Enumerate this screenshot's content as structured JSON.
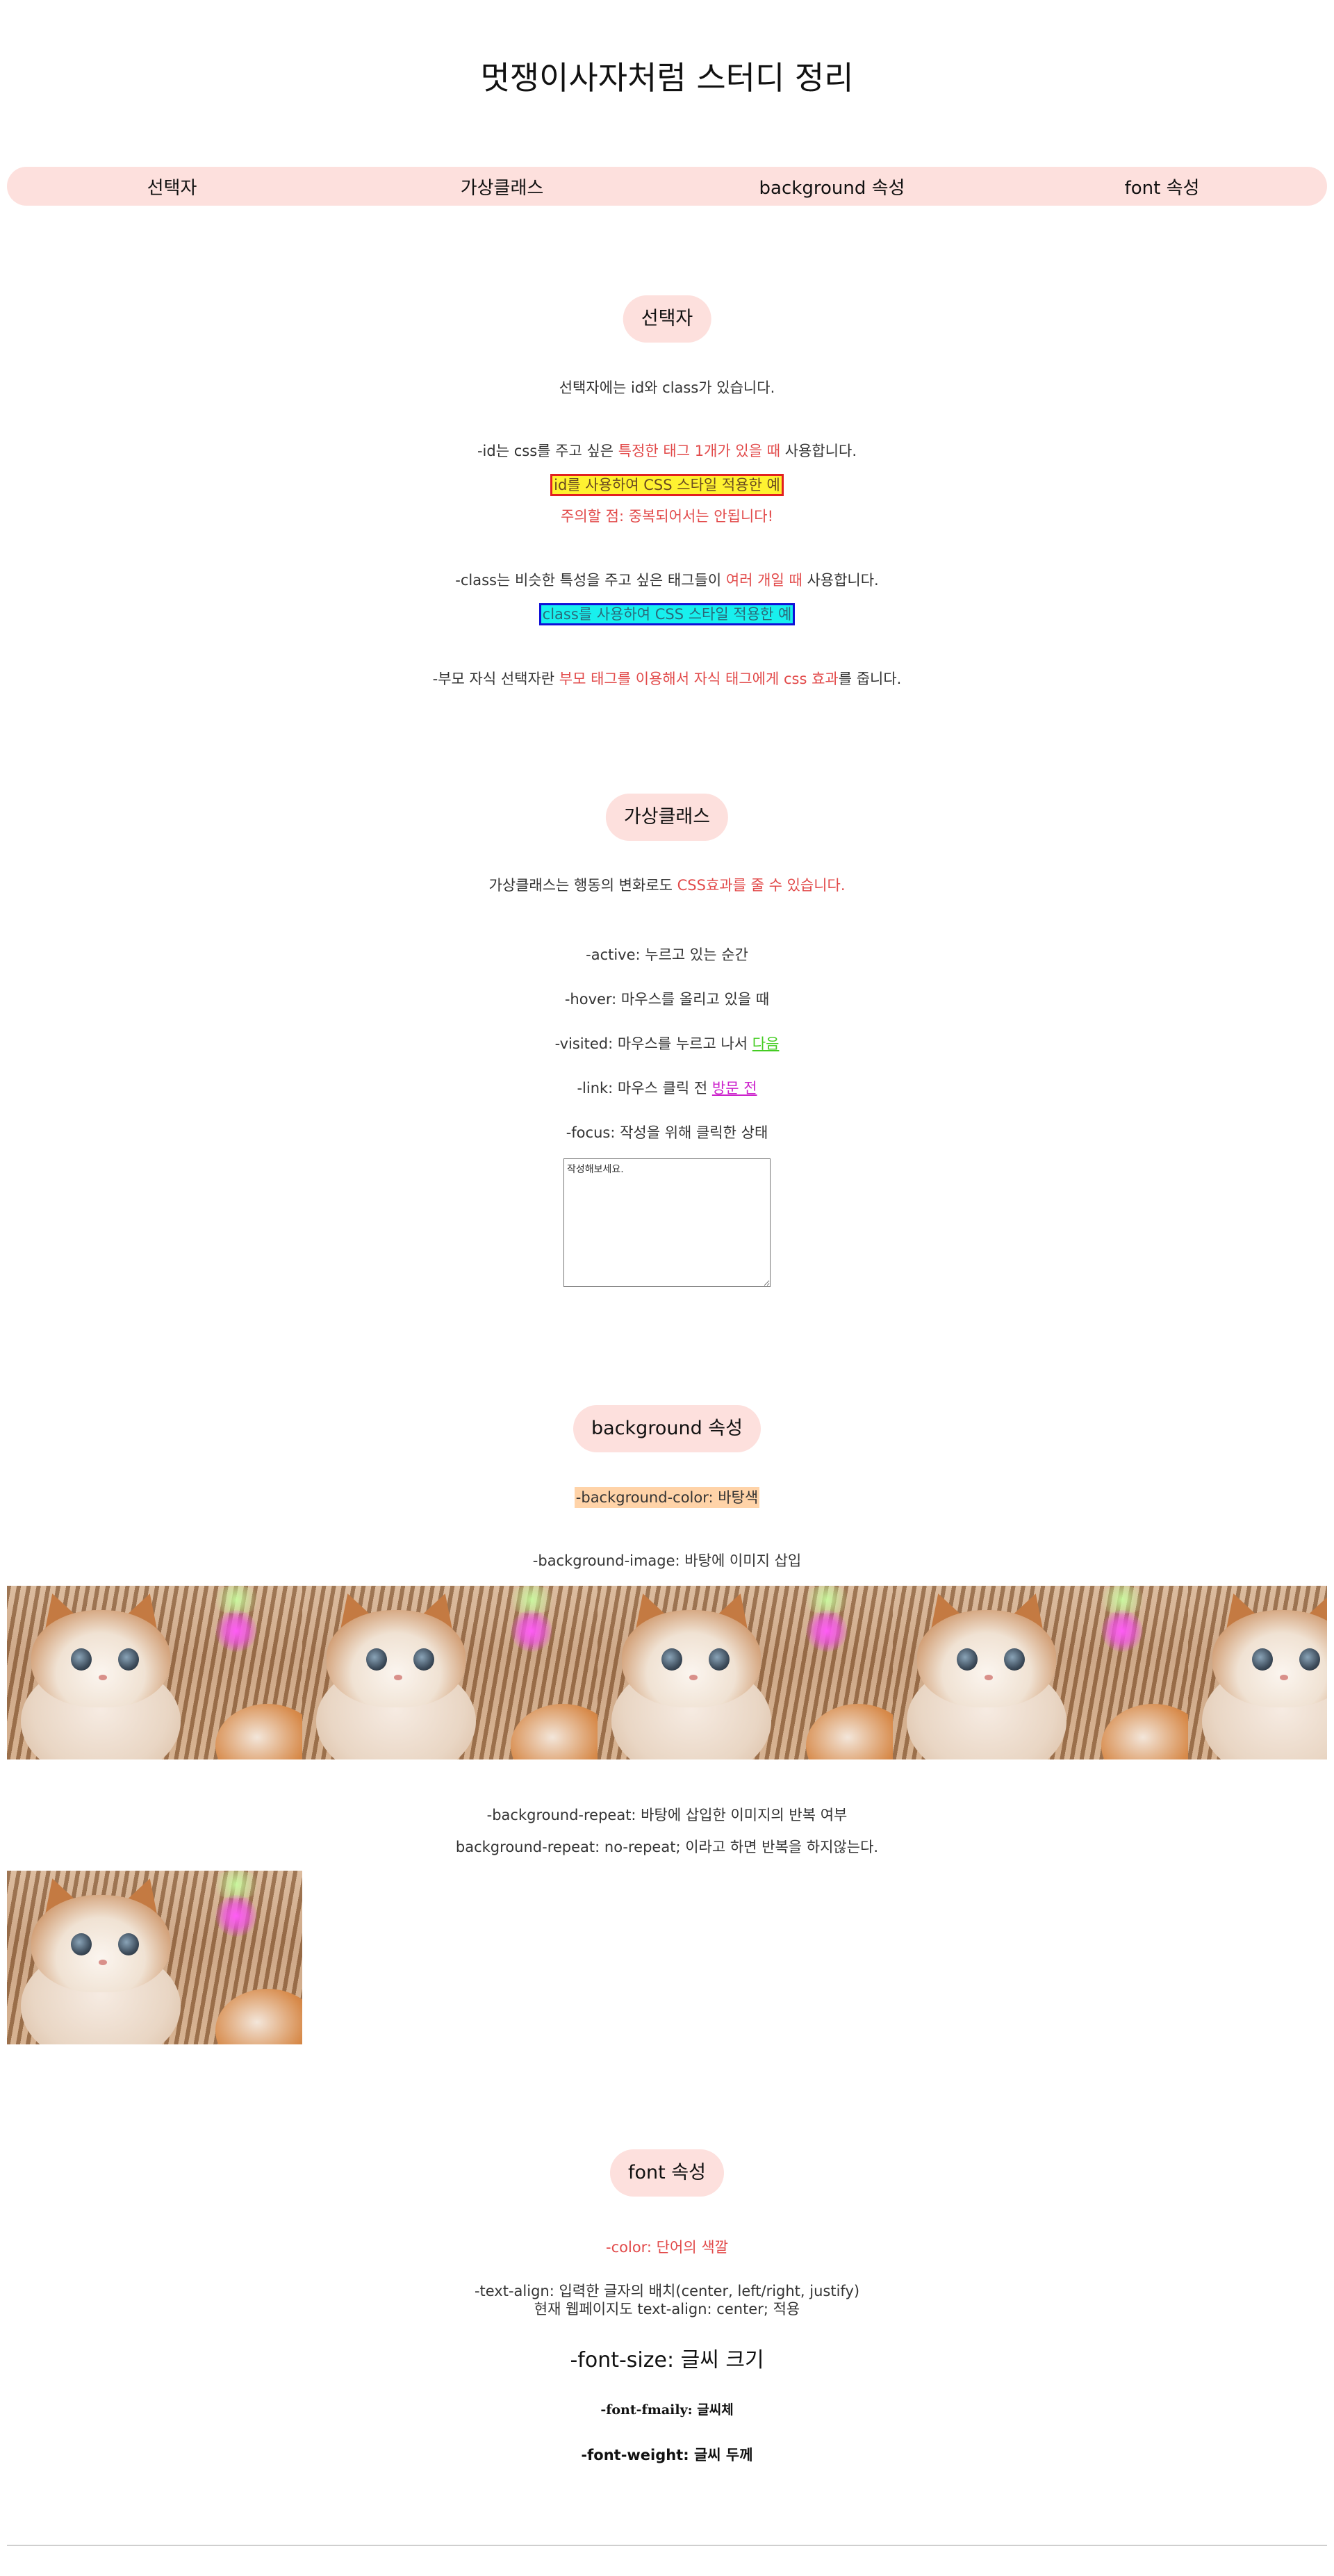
{
  "page": {
    "title": "멋쟁이사자처럼 스터디 정리"
  },
  "nav": {
    "items": [
      {
        "label": "선택자"
      },
      {
        "label": "가상클래스"
      },
      {
        "label": "background 속성"
      },
      {
        "label": "font 속성"
      }
    ]
  },
  "selector": {
    "heading": "선택자",
    "intro": "선택자에는 id와 class가 있습니다.",
    "id_line": {
      "pre": "-id는 css를 주고 싶은 ",
      "highlight": "특정한 태그 1개가 있을 때",
      "post": " 사용합니다."
    },
    "id_example": "id를 사용하여 CSS 스타일 적용한 예",
    "warning": "주의할 점: 중복되어서는 안됩니다!",
    "class_line": {
      "pre": "-class는 비슷한 특성을 주고 싶은 태그들이 ",
      "highlight": "여러 개일 때",
      "post": " 사용합니다."
    },
    "class_example": "class를 사용하여 CSS 스타일 적용한 예",
    "parent_child_line": {
      "pre": "-부모 자식 선택자란 ",
      "highlight": "부모 태그를 이용해서 자식 태그에게 css 효과",
      "post": "를 줍니다."
    }
  },
  "pseudo": {
    "heading": "가상클래스",
    "intro": {
      "pre": "가상클래스는 행동의 변화로도 ",
      "highlight": "CSS효과를 줄 수 있습니다."
    },
    "active": "-active: 누르고 있는 순간",
    "hover": "-hover: 마우스를 올리고 있을 때",
    "visited": {
      "text": "-visited: 마우스를 누르고 나서 ",
      "link": "다음"
    },
    "link": {
      "text": "-link: 마우스 클릭 전 ",
      "link": "방문 전"
    },
    "focus": "-focus: 작성을 위해 클릭한 상태",
    "textarea_value": "작성해보세요."
  },
  "background": {
    "heading": "background 속성",
    "color_line": "-background-color: 바탕색",
    "image_line": "-background-image: 바탕에 이미지 삽입",
    "repeat_line": "-background-repeat: 바탕에 삽입한 이미지의 반복 여부",
    "no_repeat_line": "background-repeat: no-repeat; 이라고 하면 반복을 하지않는다.",
    "image_subject": "kitten-photo",
    "highlight_color": "#ffd3a8"
  },
  "font": {
    "heading": "font 속성",
    "color_line": "-color: 단어의 색깔",
    "text_align_line1": "-text-align: 입력한 글자의 배치(center, left/right, justify)",
    "text_align_line2": "현재 웹페이지도 text-align: center; 적용",
    "font_size_line": "-font-size: 글씨 크기",
    "font_family_line": "-font-fmaily: 글씨체",
    "font_weight_line": "-font-weight: 글씨 두께"
  },
  "colors": {
    "pill_bg": "#fde0dd",
    "accent_red": "#e24a4a",
    "id_box_bg": "#fff231",
    "id_box_border": "#e22020",
    "class_box_bg": "#18f0ee",
    "class_box_border": "#1010d8",
    "visited_link": "#44cc22",
    "unvisited_link": "#cc22cc"
  }
}
